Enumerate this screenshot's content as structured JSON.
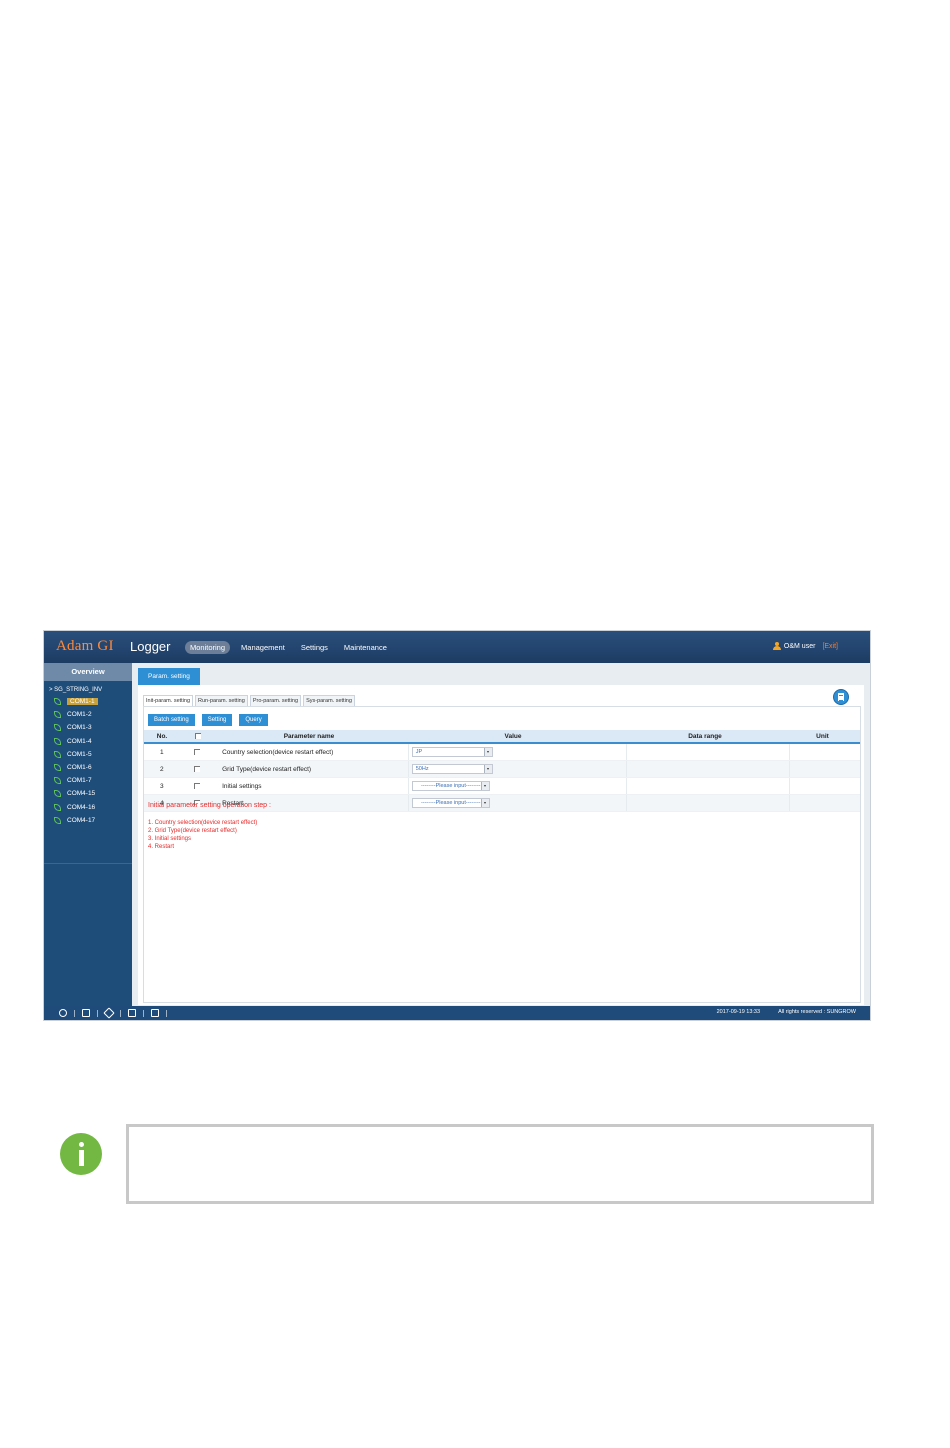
{
  "header": {
    "brand": "Adam GI",
    "product": "Logger",
    "nav": [
      "Monitoring",
      "Management",
      "Settings",
      "Maintenance"
    ],
    "active_nav": "Monitoring",
    "user": "O&M user",
    "exit": "[Exit]"
  },
  "sidebar": {
    "title": "Overview",
    "group": "> SG_STRING_INV",
    "items": [
      "COM1-1",
      "COM1-2",
      "COM1-3",
      "COM1-4",
      "COM1-5",
      "COM1-6",
      "COM1-7",
      "COM4-15",
      "COM4-16",
      "COM4-17"
    ],
    "active_item": "COM1-1"
  },
  "main": {
    "page_tab": "Param. setting",
    "subtabs": [
      "Init-param. setting",
      "Run-param. setting",
      "Pro-param. setting",
      "Sys-param. setting"
    ],
    "active_subtab": "Init-param. setting",
    "buttons": {
      "batch": "Batch setting",
      "setting": "Setting",
      "query": "Query"
    },
    "table": {
      "headers": {
        "no": "No.",
        "name": "Parameter name",
        "value": "Value",
        "range": "Data range",
        "unit": "Unit"
      },
      "rows": [
        {
          "no": "1",
          "name": "Country selection(device restart effect)",
          "value": "JP"
        },
        {
          "no": "2",
          "name": "Grid Type(device restart effect)",
          "value": "50Hz"
        },
        {
          "no": "3",
          "name": "Initial settings",
          "value": "--------Please input--------"
        },
        {
          "no": "4",
          "name": "Restart",
          "value": "--------Please input--------"
        }
      ]
    },
    "notes": {
      "title": "Initial parameter setting operation step :",
      "steps": [
        "1. Country selection(device restart effect)",
        "2. Grid Type(device restart effect)",
        "3. Initial settings",
        "4. Restart"
      ]
    }
  },
  "footer": {
    "datetime": "2017-09-19 13:33",
    "rights": "All rights reserved : SUNGROW"
  }
}
